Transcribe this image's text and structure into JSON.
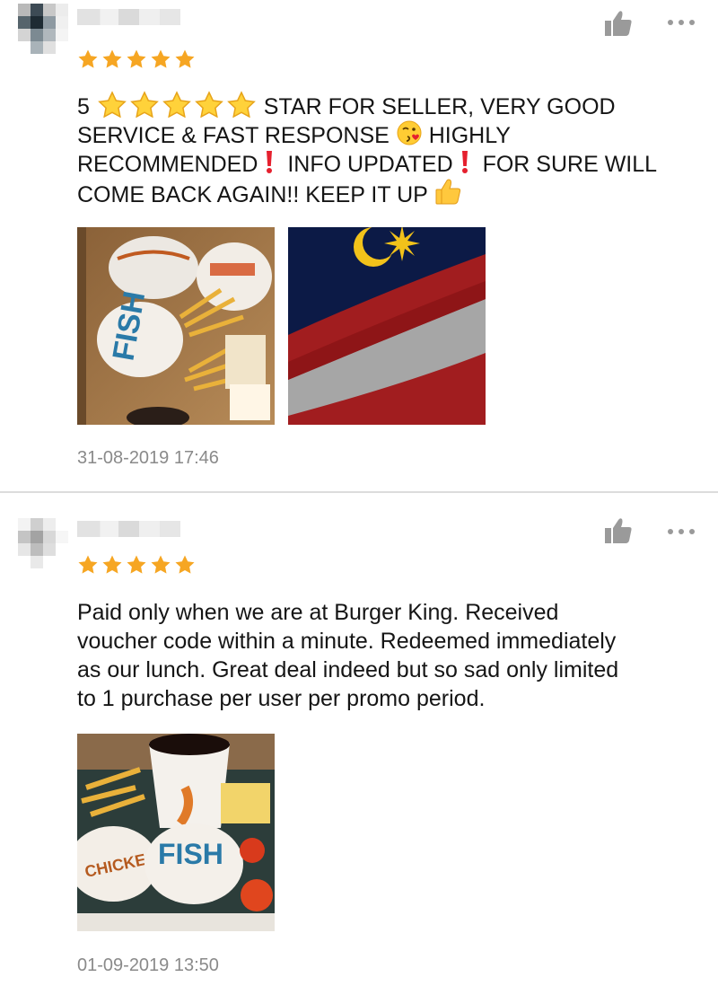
{
  "reviews": [
    {
      "rating": 5,
      "text_parts": {
        "p1": "5 ",
        "p2": " STAR FOR SELLER, VERY GOOD",
        "p3": "SERVICE & FAST RESPONSE ",
        "p4": " HIGHLY",
        "p5": "RECOMMENDED",
        "p6": " INFO UPDATED",
        "p7": " FOR SURE WILL",
        "p8": "COME BACK AGAIN!! KEEP IT UP "
      },
      "timestamp": "31-08-2019 17:46",
      "photos": [
        "burger-meal-tray",
        "malaysia-flag"
      ]
    },
    {
      "rating": 5,
      "text": "Paid only when we are at Burger King. Received\nvoucher code within a minute. Redeemed immediately\nas our lunch. Great deal indeed but so sad only limited\nto 1 purchase per user per promo period.",
      "timestamp": "01-09-2019 13:50",
      "photos": [
        "fish-burger-meal"
      ]
    }
  ],
  "colors": {
    "star": "#f6a623",
    "icon_gray": "#9a9a9a",
    "timestamp": "#8a8a8a",
    "divider": "#dcdcdc"
  }
}
